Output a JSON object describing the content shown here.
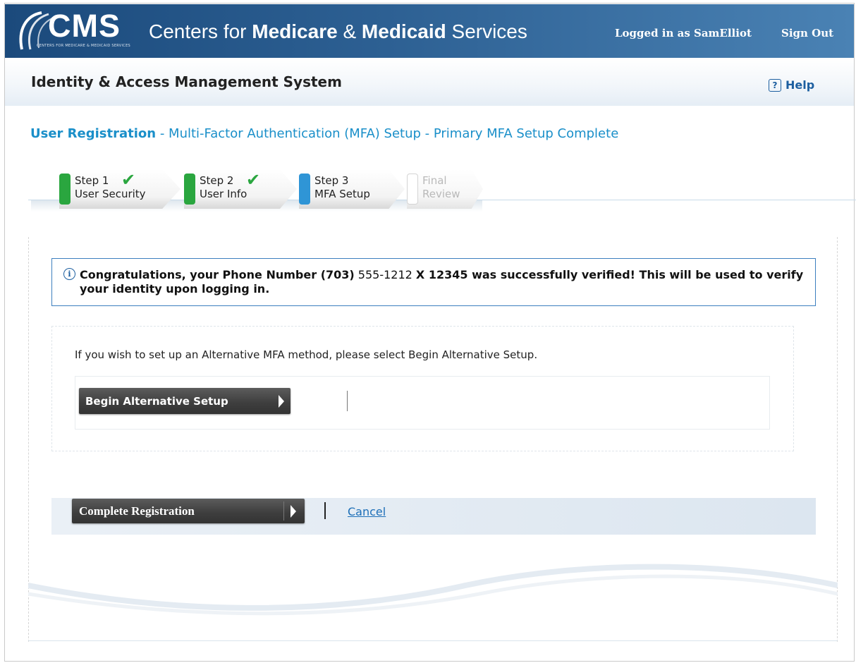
{
  "header": {
    "logo_text": "CMS",
    "logo_subtext": "CENTERS FOR MEDICARE & MEDICAID SERVICES",
    "agency_prefix": "Centers for ",
    "agency_medicare": "Medicare",
    "agency_amp": " & ",
    "agency_medicaid": "Medicaid",
    "agency_suffix": " Services",
    "logged_in": "Logged in as SamElliot",
    "sign_out": "Sign Out",
    "brand_color": "#1b4a7c"
  },
  "subheader": {
    "title": "Identity & Access Management System",
    "help_icon": "?",
    "help_label": "Help"
  },
  "page": {
    "heading_strong": "User Registration",
    "heading_rest": " - Multi-Factor Authentication (MFA) Setup - Primary MFA Setup Complete"
  },
  "steps": [
    {
      "title": "Step 1",
      "label": "User Security",
      "state": "complete",
      "color": "#2aa63f"
    },
    {
      "title": "Step 2",
      "label": "User Info",
      "state": "complete",
      "color": "#2aa63f"
    },
    {
      "title": "Step 3",
      "label": "MFA Setup",
      "state": "current",
      "color": "#2f95d6"
    },
    {
      "title": "Final",
      "label": "Review",
      "state": "pending",
      "color": "#d9d9d9"
    }
  ],
  "info": {
    "icon": "i",
    "text_before": "Congratulations, your Phone Number ",
    "area_code": "(703)",
    "phone_number": " 555-1212 ",
    "text_after": " X 12345 was successfully verified! This will be used to verify your identity upon logging in."
  },
  "alternative": {
    "text": "If you wish to set up an Alternative MFA method, please select Begin Alternative Setup.",
    "button_label": "Begin Alternative Setup"
  },
  "actions": {
    "complete_label": "Complete Registration",
    "cancel_label": "Cancel"
  }
}
